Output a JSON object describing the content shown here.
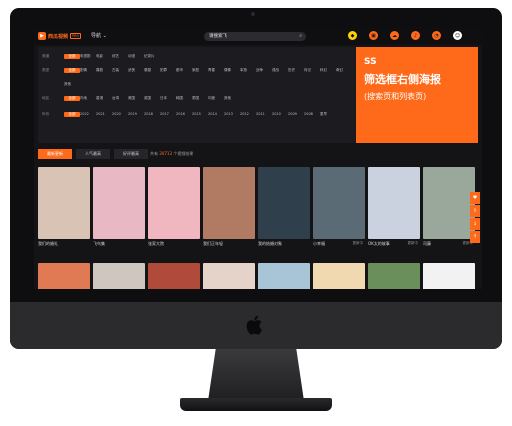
{
  "header": {
    "brand_name": "西瓜视频",
    "brand_badge": "PRO",
    "nav_label": "导航",
    "search_value": "请搜索飞",
    "icons": [
      "diamond-icon",
      "gift-icon",
      "cloud-icon",
      "bell-icon",
      "clock-icon",
      "avatar-icon"
    ]
  },
  "filters": [
    {
      "category": "频道",
      "options": [
        "全部",
        "电视剧",
        "电影",
        "综艺",
        "动漫",
        "纪录片"
      ]
    },
    {
      "category": "类型",
      "options": [
        "全部",
        "剧情",
        "喜剧",
        "古装",
        "武侠",
        "悬疑",
        "犯罪",
        "都市",
        "家庭",
        "青春",
        "偶像",
        "军旅",
        "战争",
        "谍战",
        "历史",
        "传记",
        "科幻",
        "奇幻",
        "其他"
      ]
    },
    {
      "category": "地区",
      "options": [
        "全部",
        "内地",
        "香港",
        "台湾",
        "美国",
        "英国",
        "日本",
        "韩国",
        "泰国",
        "印度",
        "其他"
      ]
    },
    {
      "category": "年份",
      "options": [
        "全部",
        "2022",
        "2021",
        "2020",
        "2019",
        "2018",
        "2017",
        "2016",
        "2015",
        "2014",
        "2013",
        "2012",
        "2011",
        "2010",
        "2009",
        "2008",
        "更早"
      ]
    }
  ],
  "poster_ad": {
    "line1": "SS",
    "line2": "筛选框右侧海报",
    "line3": "(搜索页和列表页)"
  },
  "tabs": [
    "最新更新",
    "人气最高",
    "好评最高"
  ],
  "result_info": {
    "prefix": "共有",
    "count": "30713",
    "suffix": "个视频结果"
  },
  "cards": [
    {
      "title": "我们的婚礼",
      "badge": "",
      "color": "#d9c3b5"
    },
    {
      "title": "飞鸟集",
      "badge": "",
      "color": "#e8b9c4"
    },
    {
      "title": "张家大院",
      "badge": "",
      "color": "#f0b7c0"
    },
    {
      "title": "我们正年轻",
      "badge": "",
      "color": "#b07a63"
    },
    {
      "title": "我的结婚对象",
      "badge": "",
      "color": "#2f3f4c"
    },
    {
      "title": "小幸福",
      "badge": "更新中",
      "color": "#5b6b76"
    },
    {
      "title": "OK太的故事",
      "badge": "更新中",
      "color": "#c9d2de"
    },
    {
      "title": "司藤",
      "badge": "更新中",
      "color": "#9aa79b"
    }
  ],
  "row2_colors": [
    "#e07a55",
    "#cfc6c0",
    "#b04a3a",
    "#e5d2c8",
    "#a8c5d8",
    "#f0d8b0",
    "#6b8f5a",
    "#f2f2f2"
  ],
  "side_tools": [
    "heart-icon",
    "share-icon",
    "download-icon",
    "top-icon"
  ]
}
